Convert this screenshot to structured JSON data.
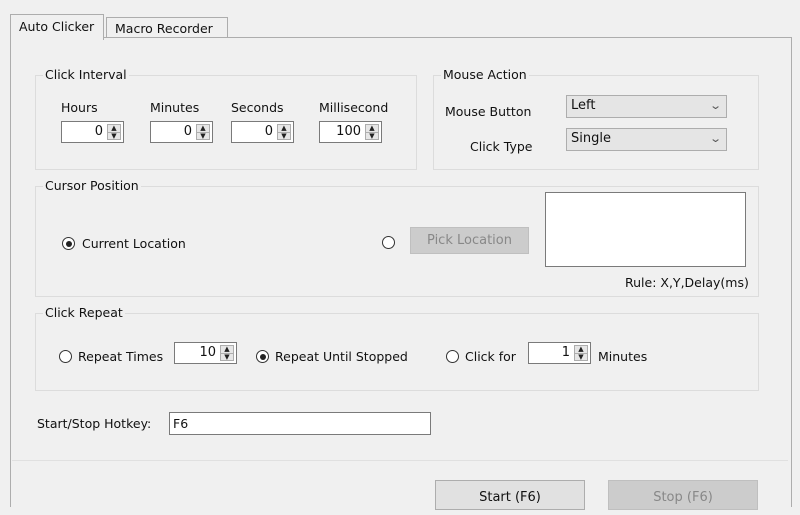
{
  "tabs": [
    {
      "label": "Auto Clicker",
      "active": true
    },
    {
      "label": "Macro Recorder",
      "active": false
    }
  ],
  "click_interval": {
    "title": "Click Interval",
    "fields": [
      {
        "label": "Hours",
        "value": "0"
      },
      {
        "label": "Minutes",
        "value": "0"
      },
      {
        "label": "Seconds",
        "value": "0"
      },
      {
        "label": "Millisecond",
        "value": "100"
      }
    ]
  },
  "mouse_action": {
    "title": "Mouse Action",
    "mouse_button_label": "Mouse Button",
    "mouse_button_value": "Left",
    "click_type_label": "Click Type",
    "click_type_value": "Single"
  },
  "cursor_position": {
    "title": "Cursor Position",
    "current_location_label": "Current Location",
    "current_location_selected": true,
    "pick_location_selected": false,
    "pick_location_button": "Pick Location",
    "coords_text": "",
    "rule_text": "Rule: X,Y,Delay(ms)"
  },
  "click_repeat": {
    "title": "Click Repeat",
    "repeat_times_label": "Repeat Times",
    "repeat_times_value": "10",
    "repeat_until_stopped_label": "Repeat Until Stopped",
    "click_for_label": "Click for",
    "click_for_value": "1",
    "minutes_label": "Minutes",
    "selected": "repeat_until_stopped"
  },
  "hotkey": {
    "label": "Start/Stop Hotkey:",
    "value": "F6"
  },
  "buttons": {
    "start": "Start (F6)",
    "stop": "Stop (F6)"
  }
}
